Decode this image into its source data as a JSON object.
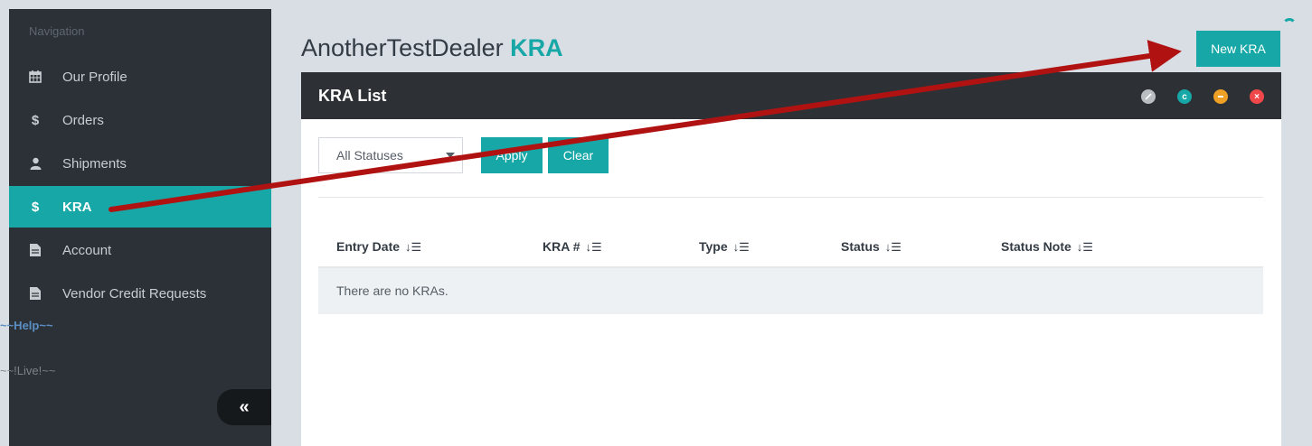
{
  "sidebar": {
    "heading": "Navigation",
    "items": [
      {
        "label": "Our Profile",
        "icon": "calendar-icon"
      },
      {
        "label": "Orders",
        "icon": "dollar-icon"
      },
      {
        "label": "Shipments",
        "icon": "user-icon"
      },
      {
        "label": "KRA",
        "icon": "dollar-icon",
        "active": true
      },
      {
        "label": "Account",
        "icon": "document-icon"
      },
      {
        "label": "Vendor Credit Requests",
        "icon": "document-icon"
      }
    ],
    "help_link": "~~Help~~",
    "live_link": "~~!Live!~~",
    "collapse_label": "«"
  },
  "page": {
    "title_prefix": "AnotherTestDealer",
    "title_accent": "KRA",
    "new_button": "New KRA"
  },
  "panel": {
    "title": "KRA List",
    "controls": [
      "expand-icon",
      "refresh-icon",
      "minimize-icon",
      "close-icon"
    ]
  },
  "filters": {
    "status_select": "All Statuses",
    "apply_label": "Apply",
    "clear_label": "Clear"
  },
  "table": {
    "columns": [
      "Entry Date",
      "KRA #",
      "Type",
      "Status",
      "Status Note"
    ],
    "sort_glyph": "↓☰",
    "empty_message": "There are no KRAs."
  },
  "colors": {
    "accent": "#17a7a7",
    "sidebar_bg": "#2c3137",
    "panel_header_bg": "#2d3136",
    "annotation_arrow": "#b01212"
  }
}
